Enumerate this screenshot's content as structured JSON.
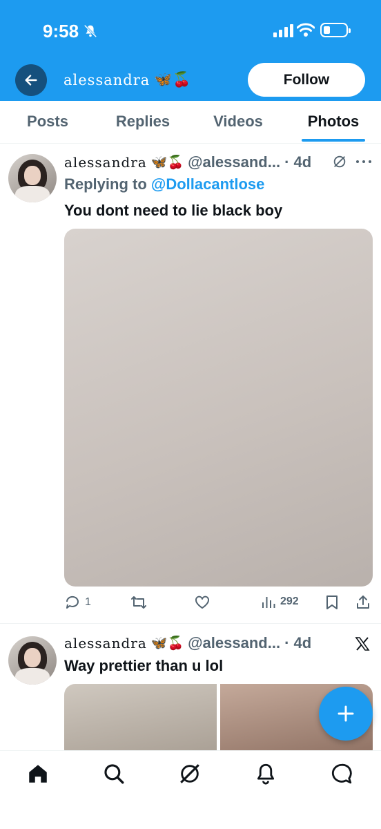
{
  "status_bar": {
    "time": "9:58"
  },
  "header": {
    "name": "alessandra",
    "emoji": "🦋🍒",
    "follow_label": "Follow"
  },
  "tabs": [
    {
      "label": "Posts",
      "active": false
    },
    {
      "label": "Replies",
      "active": false
    },
    {
      "label": "Videos",
      "active": false
    },
    {
      "label": "Photos",
      "active": true
    }
  ],
  "tweets": [
    {
      "display_name": "alessandra",
      "emoji": "🦋🍒",
      "handle": "@alessand...",
      "age": "· 4d",
      "replying_prefix": "Replying to",
      "replying_to": "@Dollacantlose",
      "text": "You dont need to lie black boy",
      "replies": "1",
      "views": "292"
    },
    {
      "display_name": "alessandra",
      "emoji": "🦋🍒",
      "handle": "@alessand...",
      "age": "· 4d",
      "text": "Way prettier than u lol"
    }
  ],
  "icons": {
    "back": "back-arrow-icon",
    "grok": "grok-icon",
    "more": "more-icon",
    "x": "x-logo-icon",
    "reply": "reply-icon",
    "retweet": "retweet-icon",
    "like": "like-icon",
    "views": "views-icon",
    "bookmark": "bookmark-icon",
    "share": "share-icon",
    "compose": "plus-icon",
    "nav": [
      "home-icon",
      "search-icon",
      "grok-icon",
      "notifications-icon",
      "messages-icon"
    ]
  },
  "colors": {
    "accent": "#1d9bf0",
    "text": "#0f1419",
    "muted": "#536471"
  }
}
